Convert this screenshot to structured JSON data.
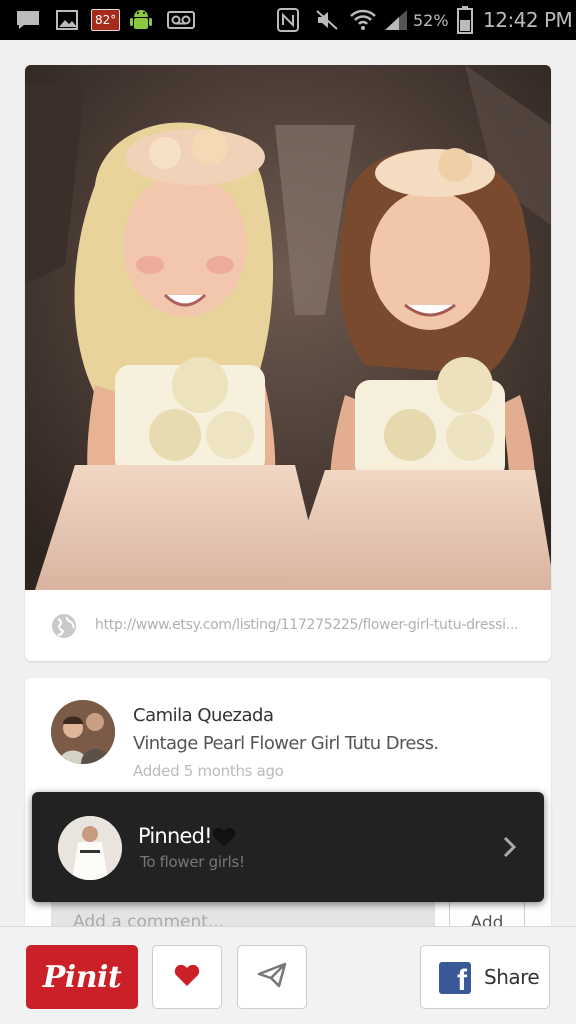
{
  "status_bar": {
    "temperature": "82°",
    "battery": "52%",
    "time": "12:42 PM"
  },
  "pin": {
    "source_url": "http://www.etsy.com/listing/117275225/flower-girl-tutu-dressi..."
  },
  "pinner": {
    "name": "Camila Quezada",
    "description": "Vintage Pearl Flower Girl Tutu Dress.",
    "added": "Added 5 months ago",
    "comment_placeholder": "Add a comment...",
    "comment_button": "Add"
  },
  "toast": {
    "title": "Pinned!",
    "subtitle": "To flower girls!"
  },
  "actions": {
    "pinit_label": "Pinit",
    "share_label": "Share"
  },
  "colors": {
    "pinterest_red": "#cb2027",
    "facebook_blue": "#3b5998",
    "toast_bg": "#222222"
  },
  "icons": {
    "status_left": [
      "chat-icon",
      "gallery-icon",
      "temperature-icon",
      "android-icon",
      "voicemail-icon"
    ],
    "status_right": [
      "nfc-icon",
      "mute-icon",
      "wifi-icon",
      "signal-icon",
      "battery-icon"
    ],
    "actions": [
      "heart-icon",
      "send-icon",
      "facebook-icon"
    ]
  }
}
